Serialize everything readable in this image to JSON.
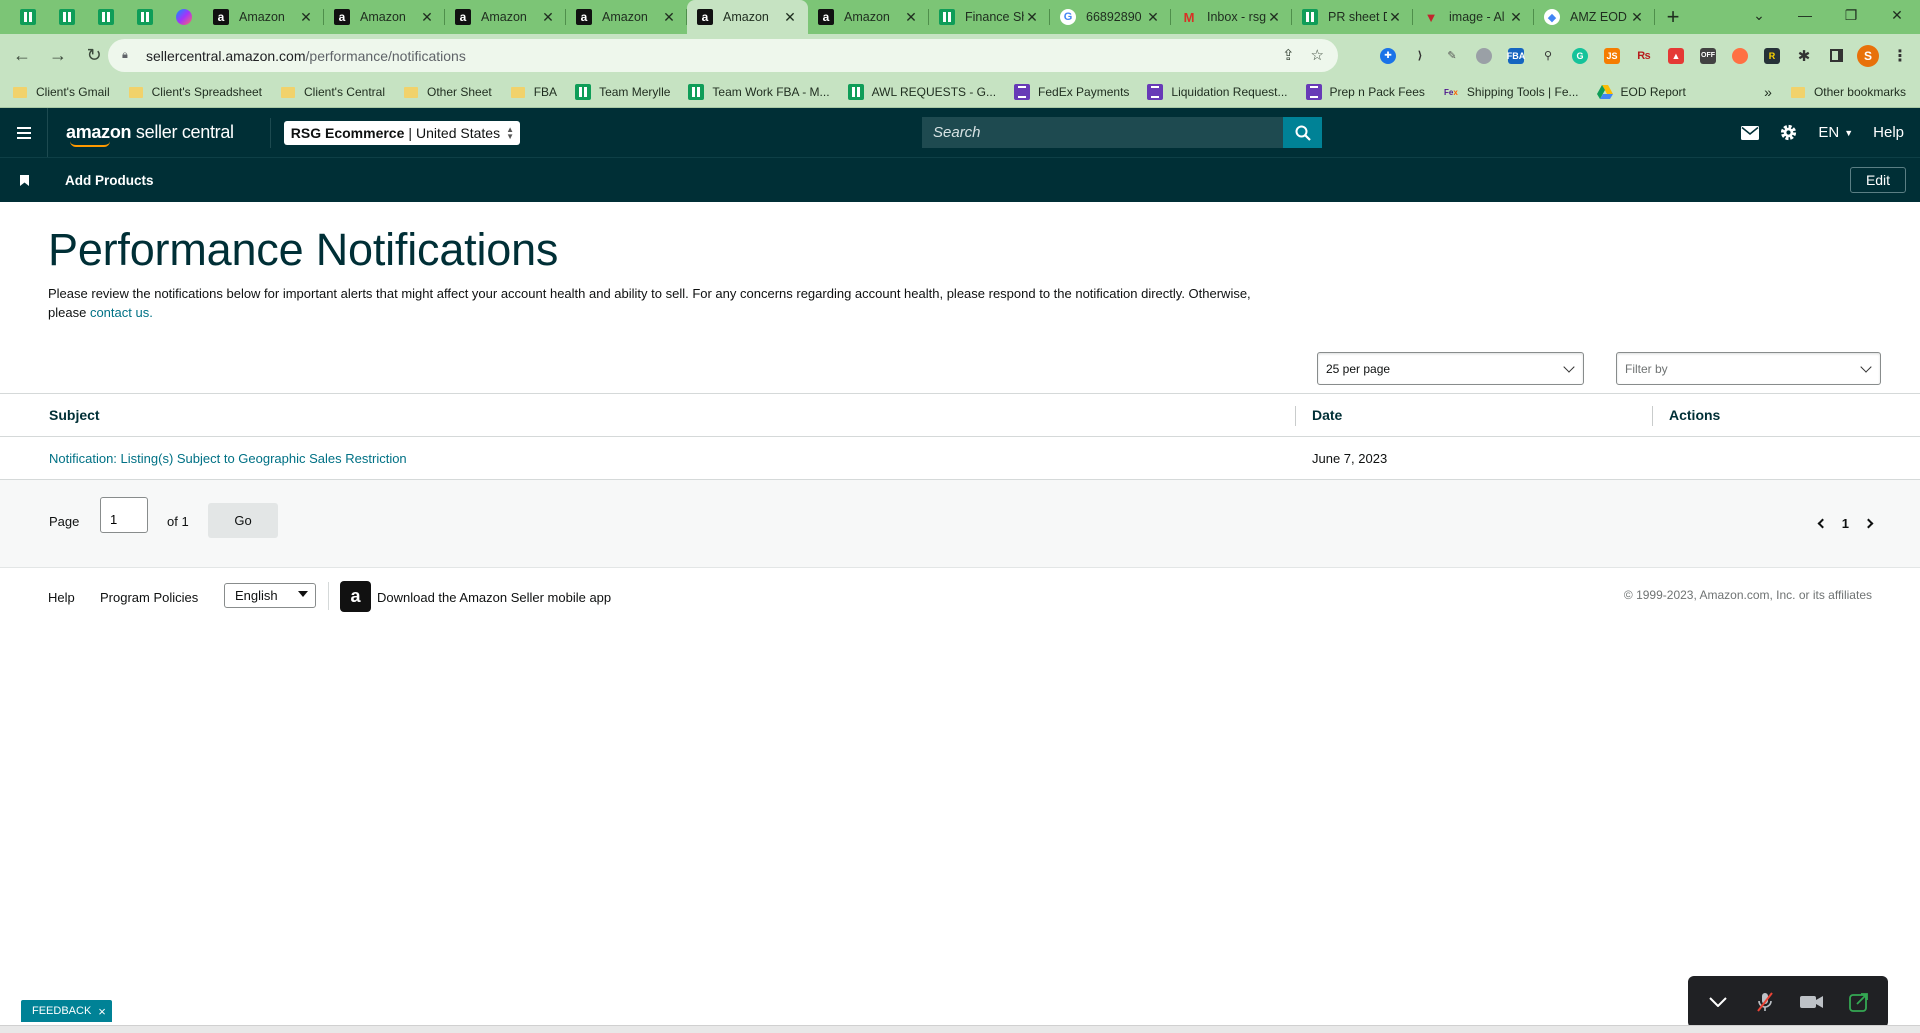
{
  "browser": {
    "tabs": [
      {
        "title": "Amazon",
        "favicon": "amazon-a-icon",
        "active": false
      },
      {
        "title": "Amazon",
        "favicon": "amazon-a-icon",
        "active": false
      },
      {
        "title": "Amazon",
        "favicon": "amazon-a-icon",
        "active": false
      },
      {
        "title": "Amazon",
        "favicon": "amazon-a-icon",
        "active": false
      },
      {
        "title": "Amazon",
        "favicon": "amazon-a-icon",
        "active": true
      },
      {
        "title": "Amazon",
        "favicon": "amazon-a-icon",
        "active": false
      },
      {
        "title": "Finance Sh",
        "favicon": "sheets-icon",
        "active": false
      },
      {
        "title": "66892890",
        "favicon": "google-icon",
        "active": false
      },
      {
        "title": "Inbox - rsg",
        "favicon": "gmail-icon",
        "active": false
      },
      {
        "title": "PR sheet D",
        "favicon": "sheets-icon",
        "active": false
      },
      {
        "title": "image - Al",
        "favicon": "v-icon",
        "active": false
      },
      {
        "title": "AMZ EOD",
        "favicon": "drive-icon",
        "active": false
      }
    ],
    "url_host": "sellercentral.amazon.com",
    "url_path": "/performance/notifications",
    "profile_initial": "S",
    "bookmarks": [
      {
        "label": "Client's Gmail",
        "icon": "folder-icon"
      },
      {
        "label": "Client's Spreadsheet",
        "icon": "folder-icon"
      },
      {
        "label": "Client's Central",
        "icon": "folder-icon"
      },
      {
        "label": "Other Sheet",
        "icon": "folder-icon"
      },
      {
        "label": "FBA",
        "icon": "folder-icon"
      },
      {
        "label": "Team Merylle",
        "icon": "sheets-icon"
      },
      {
        "label": "Team Work FBA - M...",
        "icon": "sheets-icon"
      },
      {
        "label": "AWL REQUESTS - G...",
        "icon": "sheets-icon"
      },
      {
        "label": "FedEx Payments",
        "icon": "forms-icon"
      },
      {
        "label": "Liquidation Request...",
        "icon": "forms-icon"
      },
      {
        "label": "Prep n Pack Fees",
        "icon": "forms-icon"
      },
      {
        "label": "Shipping Tools | Fe...",
        "icon": "fedex-icon"
      },
      {
        "label": "EOD Report",
        "icon": "drive-icon"
      }
    ],
    "other_bookmarks": "Other bookmarks",
    "bookmarks_overflow": "»"
  },
  "header": {
    "logo_amazon": "amazon",
    "logo_rest": " seller central",
    "account_name": "RSG Ecommerce",
    "account_region": "United States",
    "search_placeholder": "Search",
    "language": "EN",
    "help": "Help"
  },
  "subnav": {
    "link": "Add Products",
    "edit": "Edit"
  },
  "page": {
    "title": "Performance Notifications",
    "description": "Please review the notifications below for important alerts that might affect your account health and ability to sell. For any concerns regarding account health, please respond to the notification directly. Otherwise, please",
    "contact_link": "contact us.",
    "per_page": "25 per page",
    "filter_placeholder": "Filter by"
  },
  "table": {
    "headers": {
      "subject": "Subject",
      "date": "Date",
      "actions": "Actions"
    },
    "rows": [
      {
        "subject": "Notification: Listing(s) Subject to Geographic Sales Restriction",
        "date": "June 7, 2023",
        "actions": ""
      }
    ]
  },
  "pagination": {
    "page_label": "Page",
    "current_page": "1",
    "of_label": "of 1",
    "go": "Go",
    "page_number": "1"
  },
  "footer": {
    "help": "Help",
    "policies": "Program Policies",
    "language": "English",
    "app_text": "Download the Amazon Seller mobile app",
    "copyright": "© 1999-2023, Amazon.com, Inc. or its affiliates"
  },
  "feedback": {
    "label": "FEEDBACK",
    "close": "×"
  },
  "colors": {
    "browser_frame": "#7cc576",
    "toolbar": "#c6e3c2",
    "sc_header": "#002f36",
    "accent_teal": "#008296",
    "link": "#007185"
  }
}
